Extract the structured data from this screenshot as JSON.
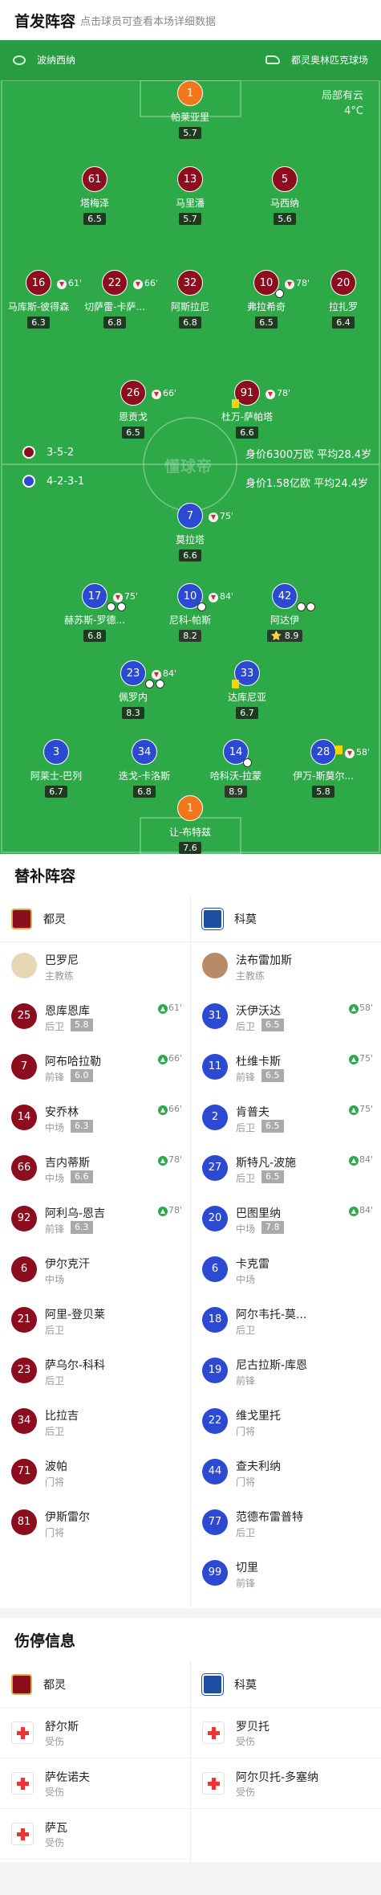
{
  "header": {
    "title": "首发阵容",
    "subtitle": "点击球员可查看本场详细数据"
  },
  "teams": {
    "left": "波纳西纳",
    "right": "都灵奥林匹克球场"
  },
  "weather": {
    "line1": "局部有云",
    "line2": "4°C"
  },
  "watermark": "懂球帝",
  "formations": {
    "home": {
      "formation": "3-5-2",
      "value": "身价6300万欧 平均28.4岁",
      "color": "#8b0d1e"
    },
    "away": {
      "formation": "4-2-3-1",
      "value": "身价1.58亿欧 平均24.4岁",
      "color": "#2c4ad1"
    }
  },
  "players_home": [
    {
      "num": "1",
      "name": "帕莱亚里",
      "rating": "5.7",
      "event": ""
    },
    {
      "num": "61",
      "name": "塔梅泽",
      "rating": "6.5",
      "event": ""
    },
    {
      "num": "13",
      "name": "马里潘",
      "rating": "5.7",
      "event": ""
    },
    {
      "num": "5",
      "name": "马西纳",
      "rating": "5.6",
      "event": ""
    },
    {
      "num": "16",
      "name": "马库斯-彼得森",
      "rating": "6.3",
      "event": "61'"
    },
    {
      "num": "22",
      "name": "切萨雷-卡萨...",
      "rating": "6.8",
      "event": "66'"
    },
    {
      "num": "32",
      "name": "阿斯拉尼",
      "rating": "6.8",
      "event": ""
    },
    {
      "num": "10",
      "name": "弗拉希奇",
      "rating": "6.5",
      "event": "78'"
    },
    {
      "num": "20",
      "name": "拉扎罗",
      "rating": "6.4",
      "event": ""
    },
    {
      "num": "26",
      "name": "恩贡戈",
      "rating": "6.5",
      "event": "66'"
    },
    {
      "num": "91",
      "name": "杜万-萨帕塔",
      "rating": "6.6",
      "event": "78'"
    }
  ],
  "players_away": [
    {
      "num": "7",
      "name": "莫拉塔",
      "rating": "6.6",
      "event": "75'"
    },
    {
      "num": "17",
      "name": "赫苏斯-罗德...",
      "rating": "6.8",
      "event": "75'"
    },
    {
      "num": "10",
      "name": "尼科-帕斯",
      "rating": "8.2",
      "event": "84'"
    },
    {
      "num": "42",
      "name": "阿达伊",
      "rating": "8.9",
      "event": ""
    },
    {
      "num": "23",
      "name": "佩罗内",
      "rating": "8.3",
      "event": "84'"
    },
    {
      "num": "33",
      "name": "达库尼亚",
      "rating": "6.7",
      "event": ""
    },
    {
      "num": "3",
      "name": "阿莱士-巴列",
      "rating": "6.7",
      "event": ""
    },
    {
      "num": "34",
      "name": "迭戈-卡洛斯",
      "rating": "6.8",
      "event": ""
    },
    {
      "num": "14",
      "name": "哈科沃-拉蒙",
      "rating": "8.9",
      "event": ""
    },
    {
      "num": "28",
      "name": "伊万-斯莫尔...",
      "rating": "5.8",
      "event": "58'"
    },
    {
      "num": "1",
      "name": "让-布特兹",
      "rating": "7.6",
      "event": ""
    }
  ],
  "subs": {
    "title": "替补阵容",
    "home_club": "都灵",
    "away_club": "科莫",
    "home_coach": {
      "name": "巴罗尼",
      "role": "主教练"
    },
    "away_coach": {
      "name": "法布雷加斯",
      "role": "主教练"
    },
    "home": [
      {
        "num": "25",
        "name": "恩库恩库",
        "pos": "后卫",
        "rating": "5.8",
        "event": "61'"
      },
      {
        "num": "7",
        "name": "阿布哈拉勒",
        "pos": "前锋",
        "rating": "6.0",
        "event": "66'"
      },
      {
        "num": "14",
        "name": "安乔林",
        "pos": "中场",
        "rating": "6.3",
        "event": "66'"
      },
      {
        "num": "66",
        "name": "吉内蒂斯",
        "pos": "中场",
        "rating": "6.6",
        "event": "78'"
      },
      {
        "num": "92",
        "name": "阿利乌-恩吉",
        "pos": "前锋",
        "rating": "6.3",
        "event": "78'"
      },
      {
        "num": "6",
        "name": "伊尔克汗",
        "pos": "中场",
        "rating": "",
        "event": ""
      },
      {
        "num": "21",
        "name": "阿里-登贝莱",
        "pos": "后卫",
        "rating": "",
        "event": ""
      },
      {
        "num": "23",
        "name": "萨乌尔-科科",
        "pos": "后卫",
        "rating": "",
        "event": ""
      },
      {
        "num": "34",
        "name": "比拉吉",
        "pos": "后卫",
        "rating": "",
        "event": ""
      },
      {
        "num": "71",
        "name": "波帕",
        "pos": "门将",
        "rating": "",
        "event": ""
      },
      {
        "num": "81",
        "name": "伊斯雷尔",
        "pos": "门将",
        "rating": "",
        "event": ""
      }
    ],
    "away": [
      {
        "num": "31",
        "name": "沃伊沃达",
        "pos": "后卫",
        "rating": "6.5",
        "event": "58'"
      },
      {
        "num": "11",
        "name": "杜维卡斯",
        "pos": "前锋",
        "rating": "6.5",
        "event": "75'"
      },
      {
        "num": "2",
        "name": "肯普夫",
        "pos": "后卫",
        "rating": "6.5",
        "event": "75'"
      },
      {
        "num": "27",
        "name": "斯特凡-波施",
        "pos": "后卫",
        "rating": "6.5",
        "event": "84'"
      },
      {
        "num": "20",
        "name": "巴图里纳",
        "pos": "中场",
        "rating": "7.8",
        "event": "84'"
      },
      {
        "num": "6",
        "name": "卡克雷",
        "pos": "中场",
        "rating": "",
        "event": ""
      },
      {
        "num": "18",
        "name": "阿尔韦托-莫...",
        "pos": "后卫",
        "rating": "",
        "event": ""
      },
      {
        "num": "19",
        "name": "尼古拉斯-库恩",
        "pos": "前锋",
        "rating": "",
        "event": ""
      },
      {
        "num": "22",
        "name": "维戈里托",
        "pos": "门将",
        "rating": "",
        "event": ""
      },
      {
        "num": "44",
        "name": "查夫利纳",
        "pos": "门将",
        "rating": "",
        "event": ""
      },
      {
        "num": "77",
        "name": "范德布雷普特",
        "pos": "后卫",
        "rating": "",
        "event": ""
      },
      {
        "num": "99",
        "name": "切里",
        "pos": "前锋",
        "rating": "",
        "event": ""
      }
    ]
  },
  "injuries": {
    "title": "伤停信息",
    "home_club": "都灵",
    "away_club": "科莫",
    "home": [
      {
        "name": "舒尔斯",
        "status": "受伤"
      },
      {
        "name": "萨佐诺夫",
        "status": "受伤"
      },
      {
        "name": "萨瓦",
        "status": "受伤"
      }
    ],
    "away": [
      {
        "name": "罗贝托",
        "status": "受伤"
      },
      {
        "name": "阿尔贝托-多塞纳",
        "status": "受伤"
      }
    ]
  },
  "colors": {
    "home": "#8b0d1e",
    "away": "#2c4ad1",
    "keeper": "#f2761b",
    "pitch": "#2ea948",
    "sub_in": "#2da84a"
  }
}
